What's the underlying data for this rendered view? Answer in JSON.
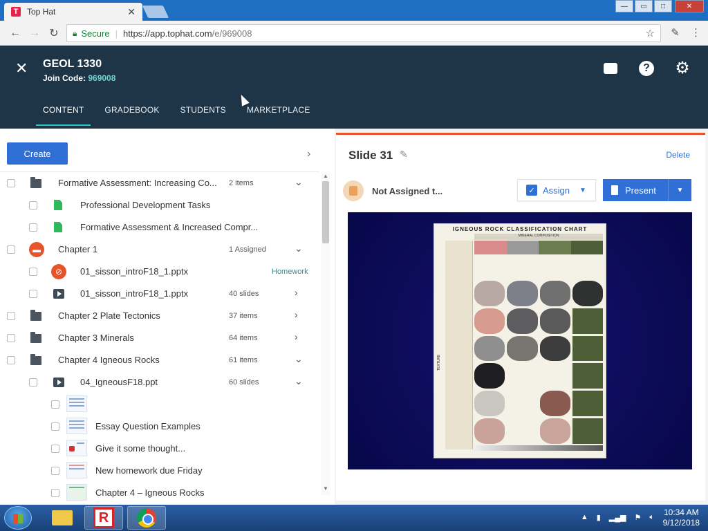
{
  "browser": {
    "tab_title": "Top Hat",
    "tab_favicon": "T",
    "secure_label": "Secure",
    "url_host": "https://app.tophat.com",
    "url_path": "/e/969008"
  },
  "header": {
    "course_title": "GEOL 1330",
    "join_label": "Join Code: ",
    "join_code": "969008",
    "tabs": [
      {
        "label": "CONTENT",
        "active": true
      },
      {
        "label": "GRADEBOOK"
      },
      {
        "label": "STUDENTS"
      },
      {
        "label": "MARKETPLACE"
      }
    ]
  },
  "left": {
    "create_label": "Create",
    "rows": [
      {
        "label": "Formative Assessment: Increasing Co...",
        "meta": "2 items",
        "icon": "folder-icon",
        "chevron": "down"
      },
      {
        "label": "Professional Development Tasks",
        "icon": "document-icon"
      },
      {
        "label": "Formative Assessment & Increased Compr...",
        "icon": "document-icon"
      },
      {
        "label": "Chapter 1",
        "meta": "1 Assigned",
        "icon": "folder-icon",
        "chevron": "down"
      },
      {
        "label": "01_sisson_introF18_1.pptx",
        "meta": "Homework",
        "icon": "attachment-icon"
      },
      {
        "label": "01_sisson_introF18_1.pptx",
        "meta": "40 slides",
        "icon": "presentation-icon",
        "chevron": "right"
      },
      {
        "label": "Chapter 2 Plate Tectonics",
        "meta": "37 items",
        "icon": "folder-icon",
        "chevron": "right"
      },
      {
        "label": "Chapter 3 Minerals",
        "meta": "64 items",
        "icon": "folder-icon",
        "chevron": "right"
      },
      {
        "label": "Chapter 4 Igneous Rocks",
        "meta": "61 items",
        "icon": "folder-icon",
        "chevron": "down"
      },
      {
        "label": "04_IgneousF18.ppt",
        "meta": "60 slides",
        "icon": "presentation-icon",
        "chevron": "down"
      },
      {
        "label": "",
        "icon": "slide-thumbnail"
      },
      {
        "label": "Essay Question Examples",
        "icon": "slide-thumbnail"
      },
      {
        "label": "Give it some thought...",
        "icon": "slide-thumbnail"
      },
      {
        "label": "New homework due Friday",
        "icon": "slide-thumbnail"
      },
      {
        "label": "Chapter 4 – Igneous Rocks",
        "icon": "slide-thumbnail"
      }
    ]
  },
  "right": {
    "slide_title": "Slide 31",
    "delete_label": "Delete",
    "status_text": "Not Assigned t...",
    "assign_label": "Assign",
    "present_label": "Present",
    "slide_image_title": "IGNEOUS ROCK CLASSIFICATION CHART",
    "slide_image_subtitle": "MINERAL COMPOSITION",
    "slide_image_side_label": "TEXTURE"
  },
  "taskbar": {
    "time": "10:34 AM",
    "date": "9/12/2018"
  },
  "colors": {
    "header_bg": "#1e3548",
    "accent_teal": "#2fc4c0",
    "primary_blue": "#2f6fd6",
    "orange": "#e8542a"
  }
}
